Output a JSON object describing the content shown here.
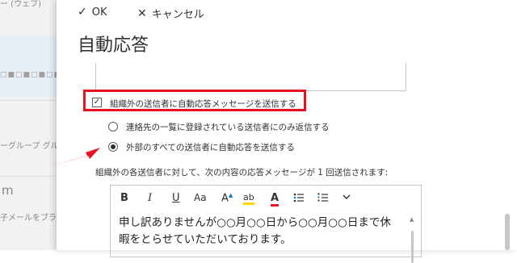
{
  "background": {
    "top_text": "ー (ウェブ)",
    "group_text": "ーグループ  グル",
    "m_text": "m",
    "mail_text": "子メールをブラウ"
  },
  "command_bar": {
    "ok_icon": "checkmark-icon",
    "ok_label": "OK",
    "cancel_icon": "close-icon",
    "cancel_label": "キャンセル"
  },
  "page_title": "自動応答",
  "external": {
    "checkbox_label": "組織外の送信者に自動応答メッセージを送信する",
    "checkbox_checked": true,
    "options": [
      {
        "label": "連絡先の一覧に登録されている送信者にのみ返信する",
        "selected": false
      },
      {
        "label": "外部のすべての送信者に自動応答を送信する",
        "selected": true
      }
    ],
    "info": "組織外の各送信者に対して、次の内容の応答メッセージが 1 回送信されます:"
  },
  "toolbar": {
    "bold": "B",
    "italic": "I",
    "underline": "U",
    "font_size": "Aa",
    "grow": "A",
    "highlight": "ab",
    "font_color": "A",
    "bullets_icon": "bullet-list-icon",
    "numbering_icon": "numbered-list-icon",
    "more_icon": "chevron-down-icon"
  },
  "message": {
    "text": "申し訳ありませんが○○月○○日から○○月○○日まで休暇をとらせていただいております。"
  },
  "colors": {
    "highlight_border": "#e81123",
    "arrow": "#e81123",
    "font_color_underline": "#e81123",
    "highlighter_yellow": "#ffd700"
  }
}
